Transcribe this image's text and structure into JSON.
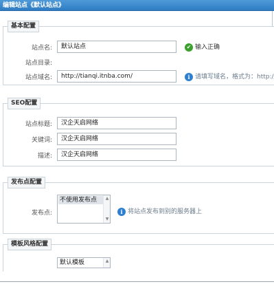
{
  "window": {
    "title": "编辑站点《默认站点》"
  },
  "basic": {
    "legend": "基本配置",
    "site_name_label": "站点名:",
    "site_name_value": "默认站点",
    "site_name_hint": "输入正确",
    "site_dir_label": "站点目录:",
    "domain_label": "站点域名:",
    "domain_value": "http://tianqi.itnba.com/",
    "domain_hint": "请填写域名，格式为：http://"
  },
  "seo": {
    "legend": "SEO配置",
    "title_label": "站点标题:",
    "title_value": "汉企天启网络",
    "keywords_label": "关键词:",
    "keywords_value": "汉企天启网络",
    "desc_label": "描述:",
    "desc_value": "汉企天启网络"
  },
  "publish": {
    "legend": "发布点配置",
    "label": "发布点:",
    "selected_option": "不使用发布点",
    "hint": "将站点发布到别的服务器上"
  },
  "template": {
    "legend": "模板风格配置",
    "selected_option": "默认模板"
  }
}
